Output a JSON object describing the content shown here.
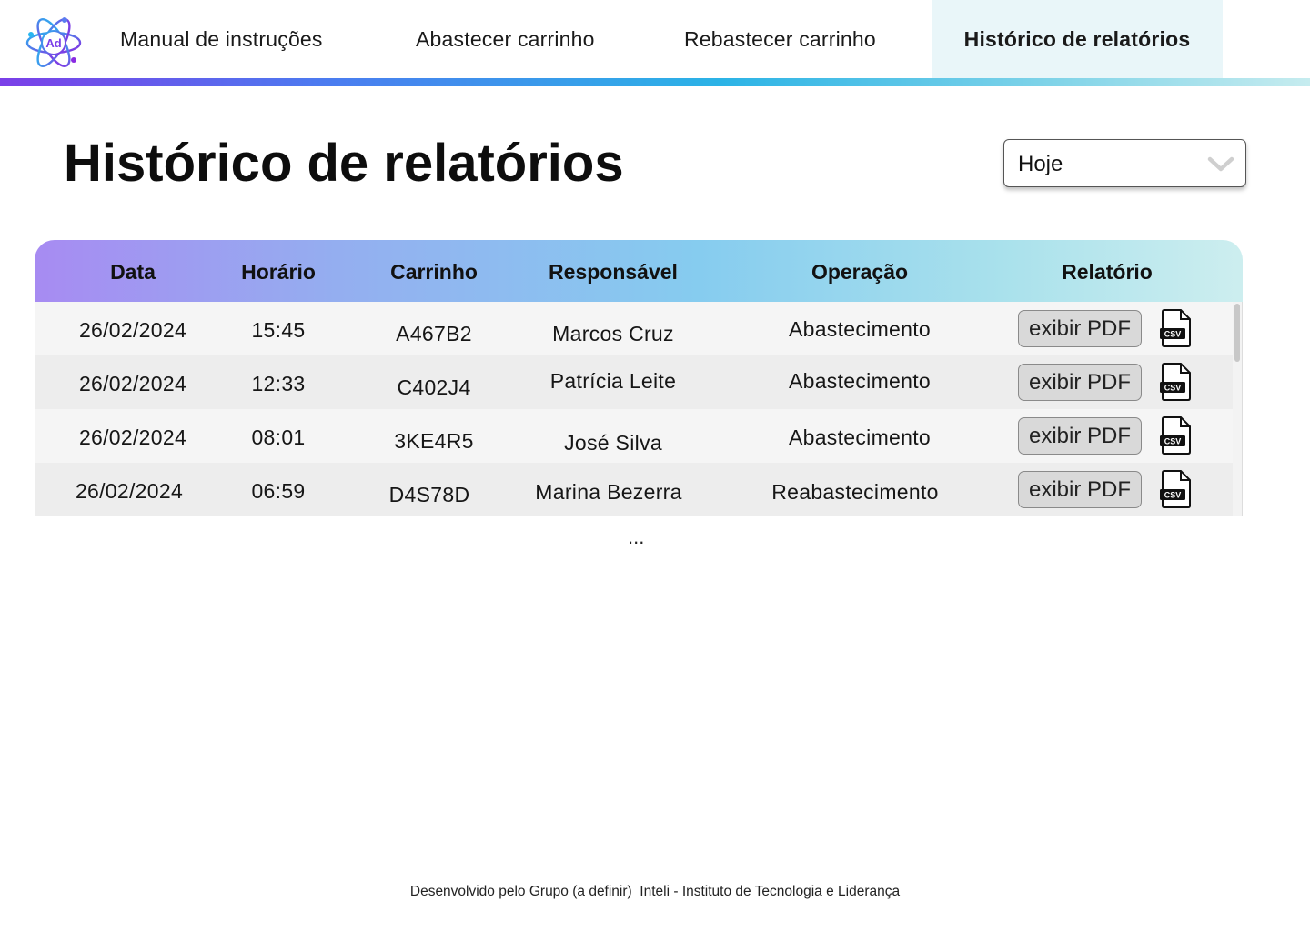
{
  "nav": {
    "logo_text": "Ad",
    "items": [
      {
        "label": "Manual de instruções"
      },
      {
        "label": "Abastecer carrinho"
      },
      {
        "label": "Rebastecer carrinho"
      },
      {
        "label": "Histórico de relatórios",
        "active": true
      }
    ]
  },
  "page": {
    "title": "Histórico de relatórios",
    "period_select": {
      "value": "Hoje"
    }
  },
  "table": {
    "headers": [
      "Data",
      "Horário",
      "Carrinho",
      "Responsável",
      "Operação",
      "Relatório"
    ],
    "rows": [
      {
        "data": "26/02/2024",
        "horario": "15:45",
        "carrinho": "A467B2",
        "responsavel": "Marcos Cruz",
        "operacao": "Abastecimento",
        "pdf_label": "exibir PDF",
        "csv_label": "CSV"
      },
      {
        "data": "26/02/2024",
        "horario": "12:33",
        "carrinho": "C402J4",
        "responsavel": "Patrícia Leite",
        "operacao": "Abastecimento",
        "pdf_label": "exibir PDF",
        "csv_label": "CSV"
      },
      {
        "data": "26/02/2024",
        "horario": "08:01",
        "carrinho": "3KE4R5",
        "responsavel": "José Silva",
        "operacao": "Abastecimento",
        "pdf_label": "exibir PDF",
        "csv_label": "CSV"
      },
      {
        "data": "26/02/2024",
        "horario": "06:59",
        "carrinho": "D4S78D",
        "responsavel": "Marina Bezerra",
        "operacao": "Reabastecimento",
        "pdf_label": "exibir PDF",
        "csv_label": "CSV"
      }
    ],
    "more_indicator": "..."
  },
  "footer": {
    "text": "Desenvolvido pelo Grupo (a definir)  Inteli - Instituto de Tecnologia e Liderança"
  },
  "colors": {
    "accent_purple": "#7b3fe8",
    "accent_blue": "#2bb3e6",
    "active_tab_bg": "#e9f6f9"
  },
  "icons": [
    "atom-logo-icon",
    "chevron-down-icon",
    "csv-file-icon"
  ]
}
